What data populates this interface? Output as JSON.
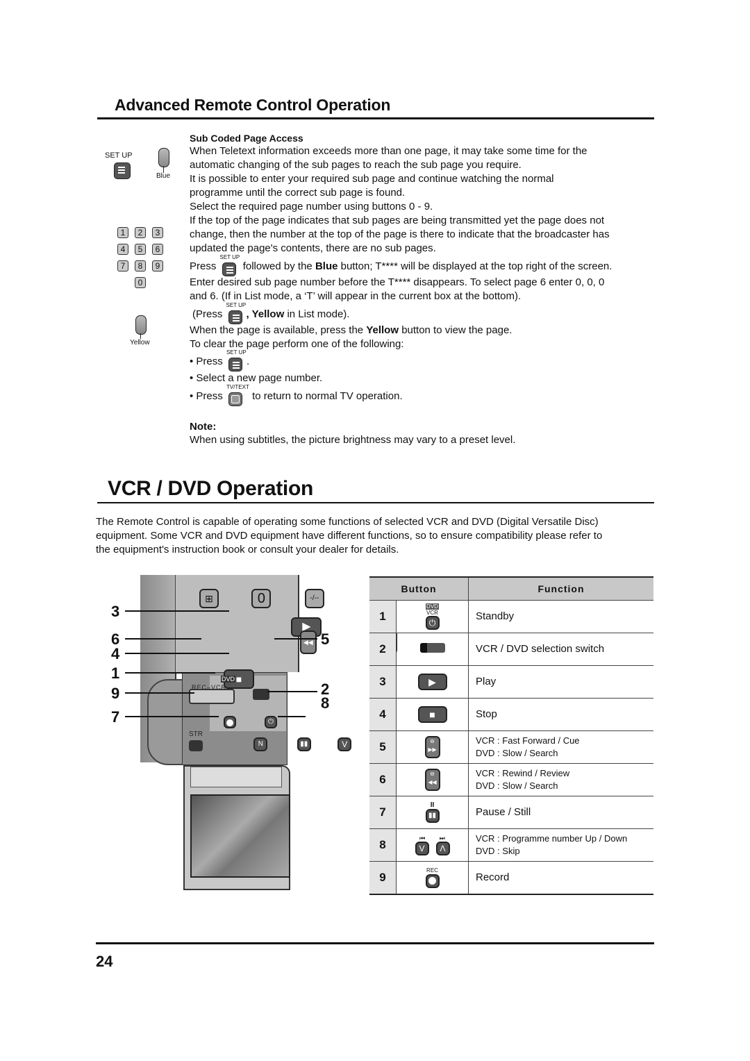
{
  "section1": {
    "title": "Advanced Remote Control Operation",
    "subheading": "Sub Coded Page Access",
    "paragraphs": [
      "When Teletext information exceeds more than one page, it may take some time for the",
      "automatic changing of the sub pages to reach the sub page you require.",
      "It is possible to enter your required sub page and continue watching the normal",
      "programme until the correct sub page is found.",
      "Select the required page number using buttons 0 - 9.",
      "If the top of the page indicates that sub pages are being transmitted yet the page does not",
      "change, then the number at the top of the page is there to indicate that the broadcaster has",
      "updated the page's contents, there are no sub pages."
    ],
    "press_line": {
      "pre": "Press",
      "post_pre": "followed by the",
      "bold": "Blue",
      "post": "button; T**** will be displayed at the top right of the screen."
    },
    "enter_lines": [
      "Enter desired sub page number before the T**** disappears. To select page 6 enter 0, 0, 0",
      "and 6. (If in List mode, a ‘T’ will appear in the current box at the bottom)."
    ],
    "list_mode_line": {
      "pre": "(Press",
      "bold": ", Yellow",
      "post": "in List mode)."
    },
    "yellow_line": {
      "pre": "When the page is available, press the",
      "bold": "Yellow",
      "post": "button to view the page."
    },
    "clear_line": "To clear the page perform one of the following:",
    "bullets": [
      {
        "pre": "• Press",
        "post": "."
      },
      {
        "text": "• Select a new page number."
      },
      {
        "pre": "• Press",
        "post": "to return to normal TV operation."
      }
    ],
    "note_label": "Note:",
    "note_text": "When using subtitles, the picture brightness may vary to a preset level.",
    "setup_label": "SET UP",
    "tvtext_label": "TV/TEXT",
    "side": {
      "setup_label": "SET UP",
      "blue_label": "Blue",
      "yellow_label": "Yellow",
      "numkeys": [
        "1",
        "2",
        "3",
        "4",
        "5",
        "6",
        "7",
        "8",
        "9",
        "0"
      ]
    }
  },
  "section2": {
    "title": "VCR / DVD Operation",
    "intro": [
      "The Remote Control is capable of operating some functions of selected VCR and DVD (Digital Versatile Disc)",
      "equipment. Some VCR and DVD equipment have different functions, so to ensure compatibility please refer to",
      "the equipment's instruction book or consult your dealer for details."
    ],
    "remote": {
      "callouts_left": [
        "3",
        "6",
        "4",
        "1",
        "9",
        "7"
      ],
      "callouts_right": [
        "5",
        "2",
        "8"
      ],
      "labels": {
        "rec_vcr": "REC–VCR",
        "dvd": "DVD",
        "str": "STR",
        "zero": "0",
        "dash": "-/--",
        "n": "N"
      }
    },
    "table": {
      "headers": [
        "Button",
        "Function"
      ],
      "rows": [
        {
          "num": "1",
          "icon": "standby-icon",
          "icon_label": "DVD VCR",
          "lines": [
            "Standby"
          ]
        },
        {
          "num": "2",
          "icon": "selection-switch-icon",
          "lines": [
            "VCR / DVD selection switch"
          ]
        },
        {
          "num": "3",
          "icon": "play-icon",
          "lines": [
            "Play"
          ]
        },
        {
          "num": "4",
          "icon": "stop-icon",
          "lines": [
            "Stop"
          ]
        },
        {
          "num": "5",
          "icon": "fast-forward-icon",
          "lines": [
            "VCR : Fast Forward / Cue",
            "DVD : Slow / Search"
          ]
        },
        {
          "num": "6",
          "icon": "rewind-icon",
          "lines": [
            "VCR : Rewind / Review",
            "DVD : Slow / Search"
          ]
        },
        {
          "num": "7",
          "icon": "pause-icon",
          "icon_label": "II",
          "lines": [
            "Pause / Still"
          ]
        },
        {
          "num": "8",
          "icon": "skip-icon",
          "lines": [
            "VCR : Programme number Up / Down",
            "DVD : Skip"
          ]
        },
        {
          "num": "9",
          "icon": "record-icon",
          "icon_label": "REC",
          "lines": [
            "Record"
          ]
        }
      ]
    }
  },
  "footer": {
    "page_number": "24"
  }
}
